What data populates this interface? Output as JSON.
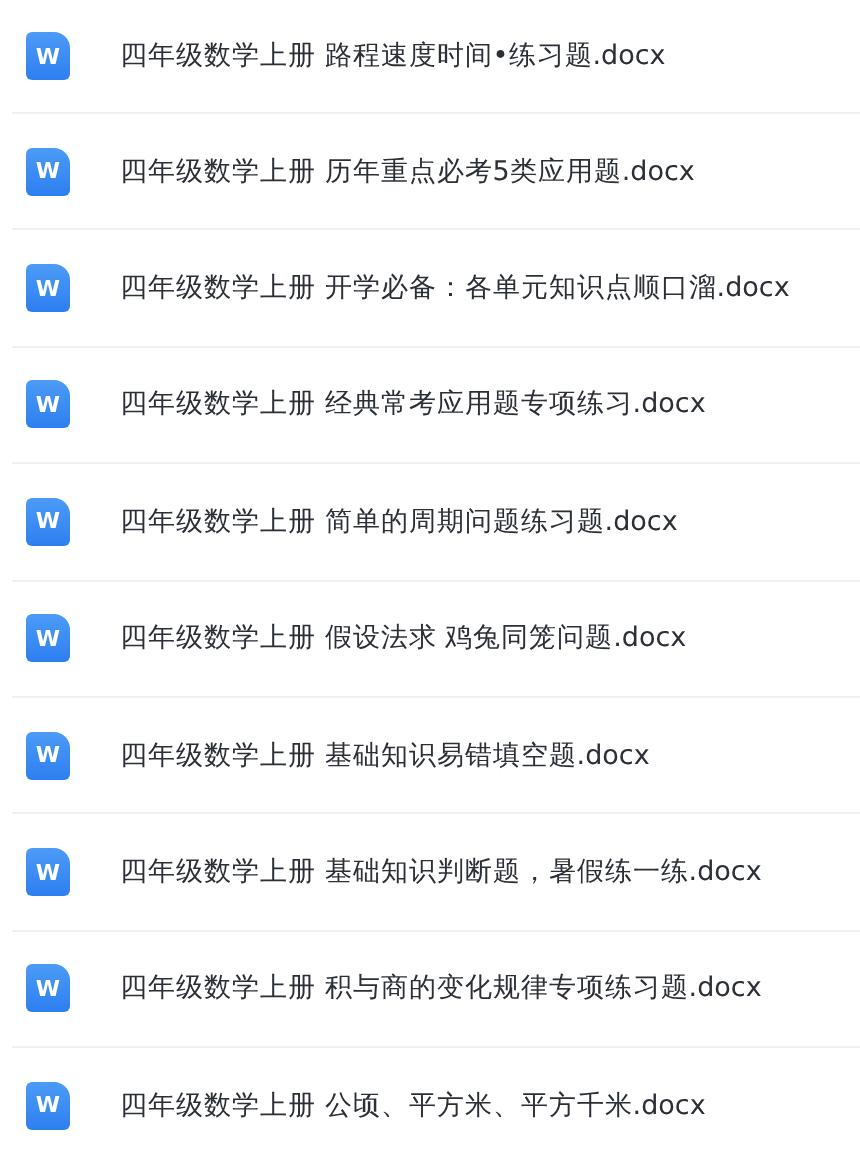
{
  "files": [
    {
      "icon": "W",
      "name": "四年级数学上册 路程速度时间•练习题.docx"
    },
    {
      "icon": "W",
      "name": "四年级数学上册 历年重点必考5类应用题.docx"
    },
    {
      "icon": "W",
      "name": "四年级数学上册 开学必备：各单元知识点顺口溜.docx"
    },
    {
      "icon": "W",
      "name": "四年级数学上册 经典常考应用题专项练习.docx"
    },
    {
      "icon": "W",
      "name": "四年级数学上册 简单的周期问题练习题.docx"
    },
    {
      "icon": "W",
      "name": "四年级数学上册 假设法求 鸡兔同笼问题.docx"
    },
    {
      "icon": "W",
      "name": "四年级数学上册 基础知识易错填空题.docx"
    },
    {
      "icon": "W",
      "name": "四年级数学上册 基础知识判断题，暑假练一练.docx"
    },
    {
      "icon": "W",
      "name": "四年级数学上册 积与商的变化规律专项练习题.docx"
    },
    {
      "icon": "W",
      "name": "四年级数学上册 公顷、平方米、平方千米.docx"
    }
  ]
}
